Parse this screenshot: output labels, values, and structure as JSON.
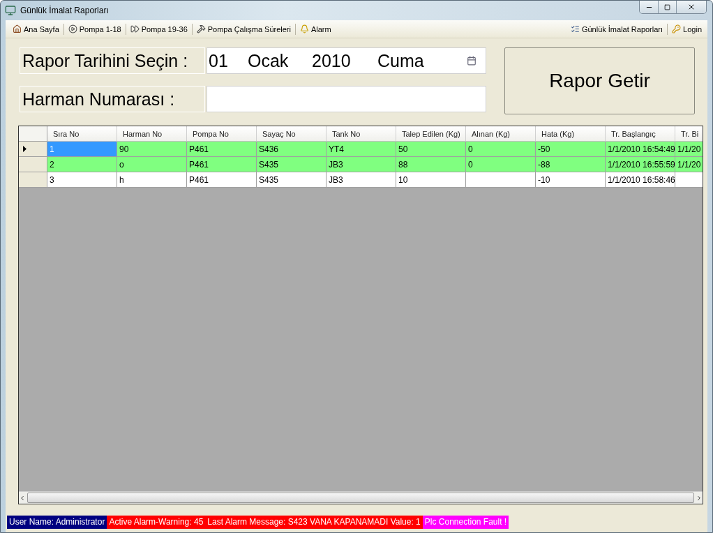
{
  "window": {
    "title": "Günlük İmalat Raporları"
  },
  "toolbar": {
    "left": [
      {
        "kind": "home",
        "label": "Ana Sayfa"
      },
      {
        "kind": "play",
        "label": "Pompa 1-18"
      },
      {
        "kind": "forward",
        "label": "Pompa 19-36"
      },
      {
        "kind": "tools",
        "label": "Pompa Çalışma Süreleri"
      },
      {
        "kind": "bell",
        "label": "Alarm"
      }
    ],
    "right": [
      {
        "kind": "list",
        "label": "Günlük İmalat Raporları"
      },
      {
        "kind": "key",
        "label": "Login"
      }
    ]
  },
  "form": {
    "date_label": "Rapor Tarihini Seçin :",
    "date": {
      "day": "01",
      "month": "Ocak",
      "year": "2010",
      "weekday": "Cuma"
    },
    "batch_label": "Harman Numarası :",
    "button": "Rapor Getir"
  },
  "table": {
    "columns": [
      "Sıra No",
      "Harman No",
      "Pompa No",
      "Sayaç No",
      "Tank No",
      "Talep Edilen (Kg)",
      "Alınan (Kg)",
      "Hata (Kg)",
      "Tr. Başlangıç",
      "Tr. Bi"
    ],
    "rows": [
      {
        "selected": true,
        "color": "#80ff80",
        "cells": [
          "1",
          "90",
          "P461",
          "S436",
          "YT4",
          "50",
          "0",
          "-50",
          "1/1/2010 16:54:49",
          "1/1/20"
        ]
      },
      {
        "selected": false,
        "color": "#80ff80",
        "cells": [
          "2",
          "o",
          "P461",
          "S435",
          "JB3",
          "88",
          "0",
          "-88",
          "1/1/2010 16:55:59",
          "1/1/20"
        ]
      },
      {
        "selected": false,
        "color": "#ffffff",
        "cells": [
          "3",
          "h",
          "P461",
          "S435",
          "JB3",
          "10",
          "",
          "-10",
          "1/1/2010 16:58:46",
          ""
        ]
      }
    ]
  },
  "status_bar": [
    {
      "text": "User Name: Administrator",
      "color": "#000080"
    },
    {
      "text": "Active Alarm-Warning: 45",
      "color": "#ff0000"
    },
    {
      "text": "Last Alarm Message: S423 VANA KAPANAMADI Value: 1",
      "color": "#ff0000"
    },
    {
      "text": "Plc Connection Fault !",
      "color": "#ff00ff"
    }
  ]
}
